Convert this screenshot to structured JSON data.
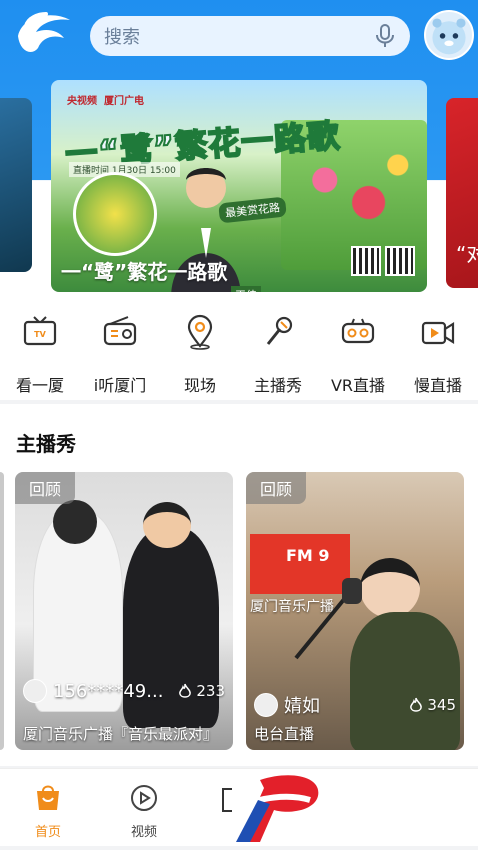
{
  "search": {
    "placeholder": "搜索"
  },
  "banner": {
    "brand": "央视频",
    "brand_partner": "厦门广电",
    "headline": "一“鹭”繁花一路歌",
    "air_time": "直播时间 1月30日 15:00",
    "slogan": "最美赏花路",
    "host_name": "王佳",
    "bottom_title": "一“鹭”繁花一路歌",
    "right_peek_text": "“对"
  },
  "quick_nav": [
    {
      "label": "看一厦",
      "icon": "tv-icon"
    },
    {
      "label": "i听厦门",
      "icon": "radio-icon"
    },
    {
      "label": "现场",
      "icon": "location-pin-icon"
    },
    {
      "label": "主播秀",
      "icon": "microphone-icon"
    },
    {
      "label": "VR直播",
      "icon": "vr-goggles-icon"
    },
    {
      "label": "慢直播",
      "icon": "camera-play-icon"
    }
  ],
  "section": {
    "title": "主播秀",
    "cards": [
      {
        "badge": "回顾",
        "user": "156****49...",
        "hot": "233",
        "desc": "厦门音乐广播『音乐最派对』"
      },
      {
        "badge": "回顾",
        "user": "婧如",
        "hot": "345",
        "desc": "电台直播",
        "board_text": "厦门音乐广播",
        "board_logo": "FM 9"
      }
    ]
  },
  "tabbar": {
    "items": [
      {
        "label": "首页",
        "icon": "home-bag-icon",
        "active": true
      },
      {
        "label": "视频",
        "icon": "play-circle-icon",
        "active": false
      }
    ]
  },
  "colors": {
    "primary": "#2b98f2",
    "accent": "#f08c1a"
  }
}
